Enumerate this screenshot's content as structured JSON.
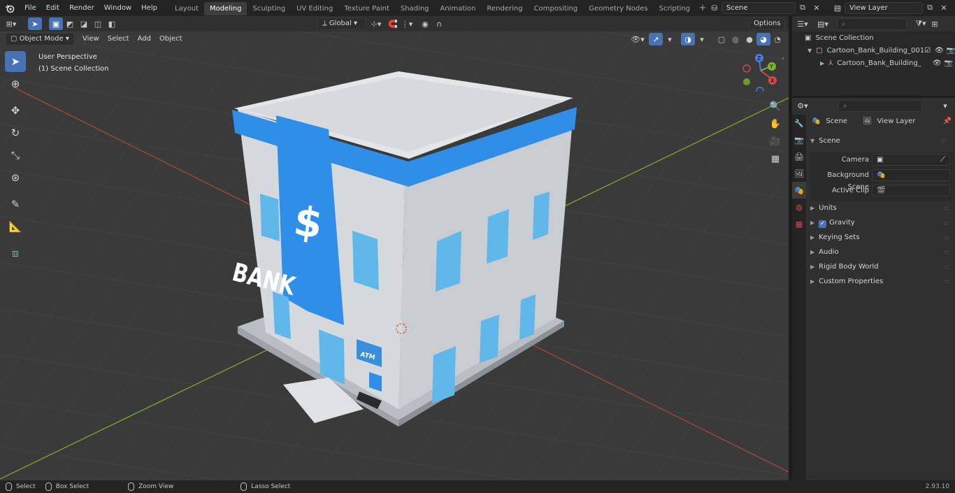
{
  "topbar": {
    "menus": [
      "File",
      "Edit",
      "Render",
      "Window",
      "Help"
    ],
    "workspaces": [
      "Layout",
      "Modeling",
      "Sculpting",
      "UV Editing",
      "Texture Paint",
      "Shading",
      "Animation",
      "Rendering",
      "Compositing",
      "Geometry Nodes",
      "Scripting"
    ],
    "active_workspace": "Modeling",
    "scene_name": "Scene",
    "view_layer": "View Layer"
  },
  "viewport": {
    "mode": "Object Mode",
    "menus": [
      "View",
      "Select",
      "Add",
      "Object"
    ],
    "transform_orientation": "Global",
    "options_label": "Options",
    "perspective_label": "User Perspective",
    "collection_label": "(1) Scene Collection",
    "gizmo_axes": {
      "z": "Z",
      "y": "Y",
      "x": "X"
    },
    "model_texts": {
      "atm": "ATM"
    }
  },
  "outliner": {
    "root": "Scene Collection",
    "items": [
      {
        "name": "Cartoon_Bank_Building_001",
        "level": 1
      },
      {
        "name": "Cartoon_Bank_Building_",
        "level": 2
      }
    ]
  },
  "properties": {
    "breadcrumb_scene": "Scene",
    "breadcrumb_layer": "View Layer",
    "section_title": "Scene",
    "fields": [
      {
        "label": "Camera"
      },
      {
        "label": "Background Scene"
      },
      {
        "label": "Active Clip"
      }
    ],
    "panels": [
      {
        "label": "Units",
        "checkbox": false
      },
      {
        "label": "Gravity",
        "checkbox": true
      },
      {
        "label": "Keying Sets",
        "checkbox": false
      },
      {
        "label": "Audio",
        "checkbox": false
      },
      {
        "label": "Rigid Body World",
        "checkbox": false
      },
      {
        "label": "Custom Properties",
        "checkbox": false
      }
    ]
  },
  "statusbar": {
    "select": "Select",
    "box_select": "Box Select",
    "zoom_view": "Zoom View",
    "lasso_select": "Lasso Select",
    "version": "2.93.10"
  },
  "colors": {
    "accent": "#4772b3",
    "building_wall": "#d6d9dd",
    "building_blue": "#2f8fe8",
    "window_blue": "#5fb7ea",
    "axis_x": "#c24a4a",
    "axis_y": "#8ab52e"
  }
}
